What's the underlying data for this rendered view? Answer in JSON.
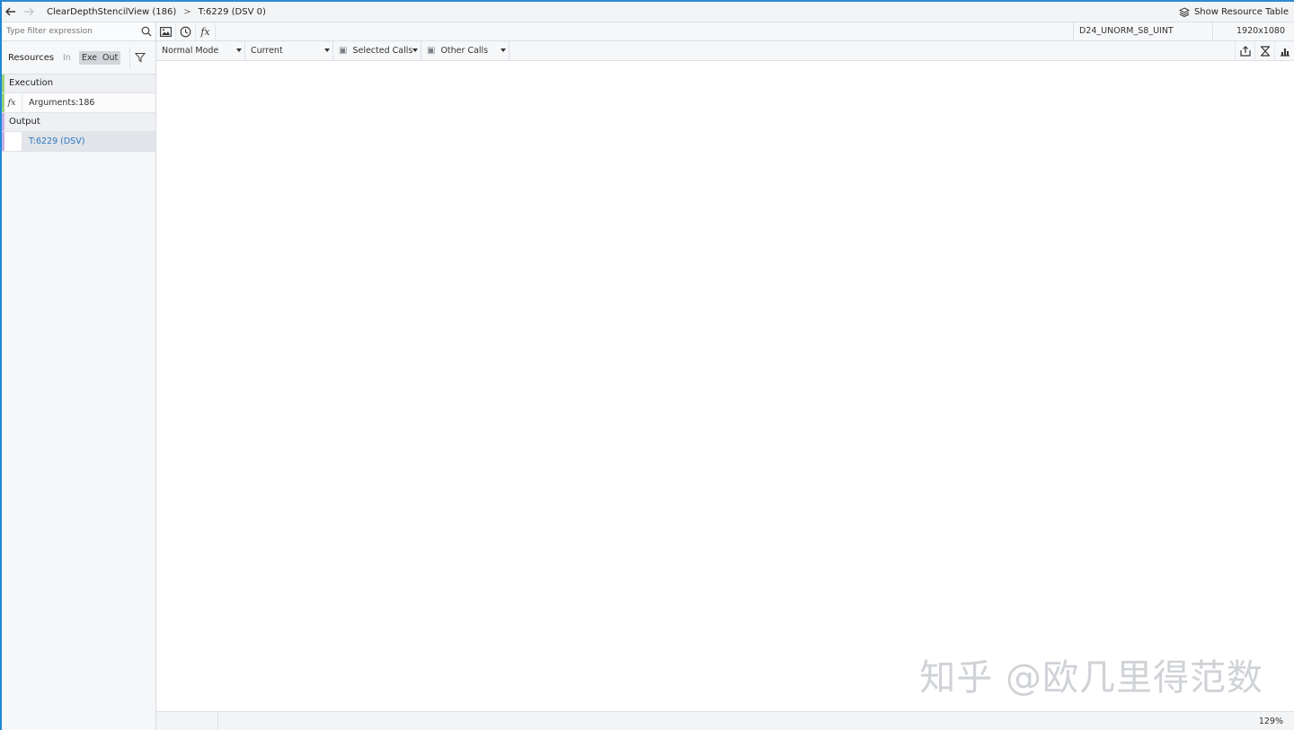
{
  "breadcrumb": {
    "back_icon": "arrow-left-icon",
    "forward_icon": "arrow-right-icon",
    "items": [
      "ClearDepthStencilView (186)",
      "T:6229 (DSV 0)"
    ],
    "separator": ">",
    "show_resource_table": "Show Resource Table"
  },
  "left_panel": {
    "filter_placeholder": "Type filter expression",
    "resources_label": "Resources",
    "toggles": [
      "In",
      "Exe",
      "Out"
    ],
    "sections": {
      "execution": "Execution",
      "arguments": "Arguments:186",
      "output": "Output",
      "output_item": "T:6229 (DSV)"
    },
    "fx_glyph": "fx"
  },
  "toolbar": {
    "fx_glyph": "fx",
    "format": "D24_UNORM_S8_UINT",
    "dimensions": "1920x1080",
    "mode": "Normal Mode",
    "current": "Current",
    "selected_calls": "Selected Calls",
    "other_calls": "Other Calls"
  },
  "watermark": "知乎 @欧几里得范数",
  "status": {
    "zoom": "129%"
  },
  "colors": {
    "accent": "#2f8ad6",
    "execution_marker": "#9bd27a",
    "output_marker": "#c7b0e6",
    "selected_text": "#2a78c2"
  }
}
